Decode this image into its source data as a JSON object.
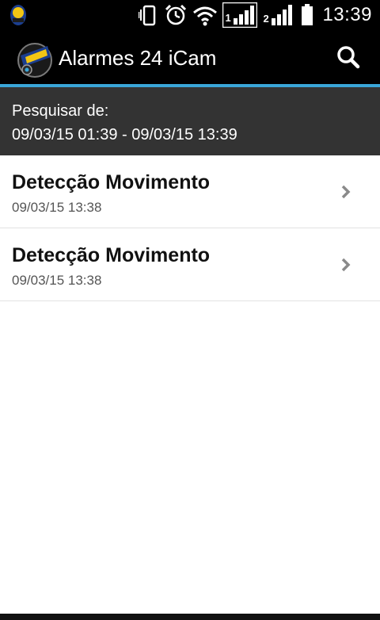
{
  "status_bar": {
    "time": "13:39",
    "sim1_label": "1",
    "sim2_label": "2",
    "icons": [
      "app-notification-icon",
      "vibrate-icon",
      "alarm-icon",
      "wifi-icon",
      "signal-sim1-icon",
      "signal-sim2-icon",
      "battery-icon"
    ]
  },
  "action_bar": {
    "title": "Alarmes 24 iCam",
    "search_icon": "search-icon",
    "accent_color": "#3aa6d8"
  },
  "filter": {
    "label": "Pesquisar de:",
    "range": "09/03/15 01:39 - 09/03/15 13:39"
  },
  "events": [
    {
      "title": "Detecção Movimento",
      "date": "09/03/15 13:38"
    },
    {
      "title": "Detecção Movimento",
      "date": "09/03/15 13:38"
    }
  ]
}
